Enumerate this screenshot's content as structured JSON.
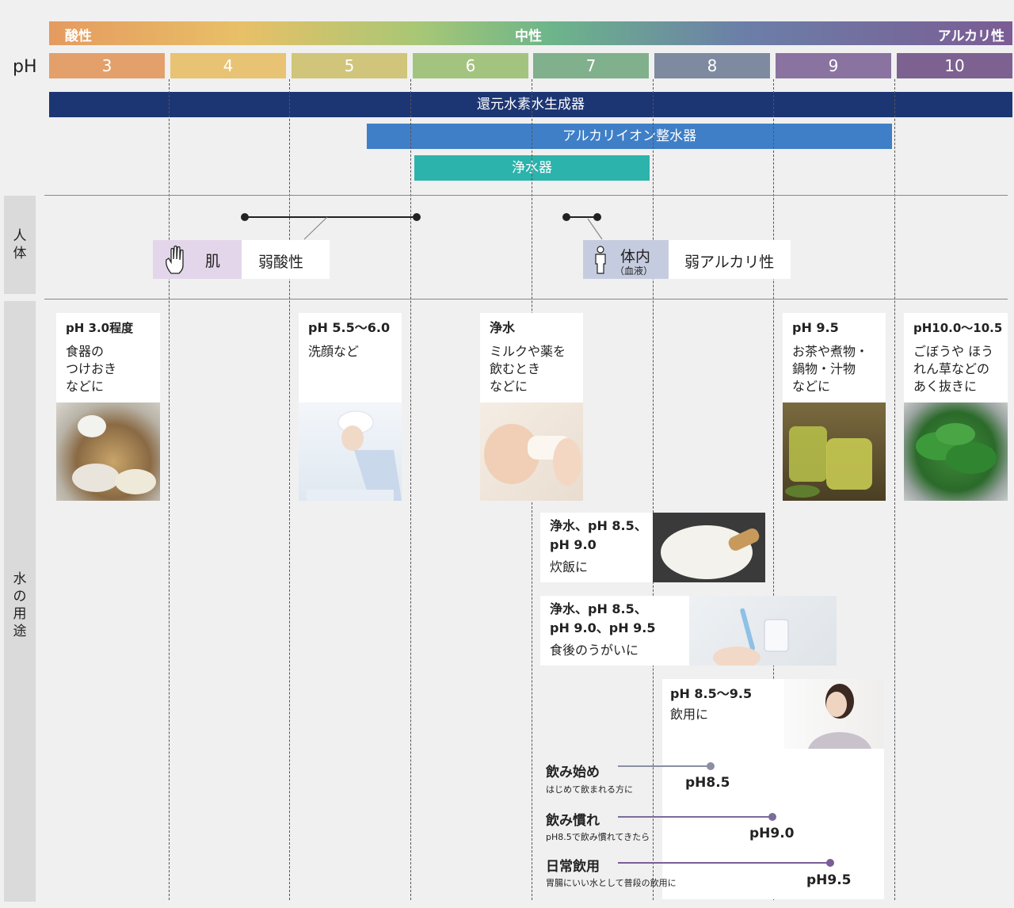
{
  "scale": {
    "acid": "酸性",
    "neutral": "中性",
    "alkaline": "アルカリ性",
    "ph_label": "pH",
    "cells": [
      {
        "value": "3",
        "color": "#e3a06a"
      },
      {
        "value": "4",
        "color": "#e7c373"
      },
      {
        "value": "5",
        "color": "#d0c57a"
      },
      {
        "value": "6",
        "color": "#a3c47f"
      },
      {
        "value": "7",
        "color": "#80b08c"
      },
      {
        "value": "8",
        "color": "#7d8aa0"
      },
      {
        "value": "9",
        "color": "#8a73a0"
      },
      {
        "value": "10",
        "color": "#7d6190"
      }
    ]
  },
  "devices": {
    "reduced": {
      "label": "還元水素水生成器",
      "color": "#1c3573"
    },
    "alkaline": {
      "label": "アルカリイオン整水器",
      "color": "#3f7fc7"
    },
    "purifier": {
      "label": "浄水器",
      "color": "#2bb3ac"
    }
  },
  "body": {
    "section": "人体",
    "skin_label": "肌",
    "skin_value": "弱酸性",
    "blood_label": "体内",
    "blood_sub": "（血液）",
    "blood_value": "弱アルカリ性"
  },
  "uses": {
    "section": "水の用途",
    "cards": [
      {
        "title": "pH 3.0程度",
        "lines": [
          "食器の",
          "つけおき",
          "などに"
        ]
      },
      {
        "title": "pH 5.5～6.0",
        "lines": [
          "洗顔など"
        ]
      },
      {
        "title": "浄水",
        "lines": [
          "ミルクや薬を",
          "飲むとき",
          "などに"
        ]
      },
      {
        "title": "pH 9.5",
        "lines": [
          "お茶や煮物・",
          "鍋物・汁物",
          "などに"
        ]
      },
      {
        "title": "pH10.0～10.5",
        "lines": [
          "ごぼうや ほう",
          "れん草などの",
          "あく抜きに"
        ]
      }
    ],
    "rice": {
      "l1": "浄水、pH 8.5、",
      "l2": "pH 9.0",
      "l3": "炊飯に"
    },
    "gargle": {
      "l1": "浄水、pH 8.5、",
      "l2": "pH 9.0、pH 9.5",
      "l3": "食後のうがいに"
    },
    "drink": {
      "title": "pH 8.5～9.5",
      "sub": "飲用に"
    },
    "steps": [
      {
        "label": "飲み始め",
        "note": "はじめて飲まれる方に",
        "ph": "pH8.5",
        "color": "#8a8fa3"
      },
      {
        "label": "飲み慣れ",
        "note": "pH8.5で飲み慣れてきたら",
        "ph": "pH9.0",
        "color": "#7b6c9a"
      },
      {
        "label": "日常飲用",
        "note": "胃腸にいい水として普段の飲用に",
        "ph": "pH9.5",
        "color": "#7a5d96"
      }
    ]
  }
}
